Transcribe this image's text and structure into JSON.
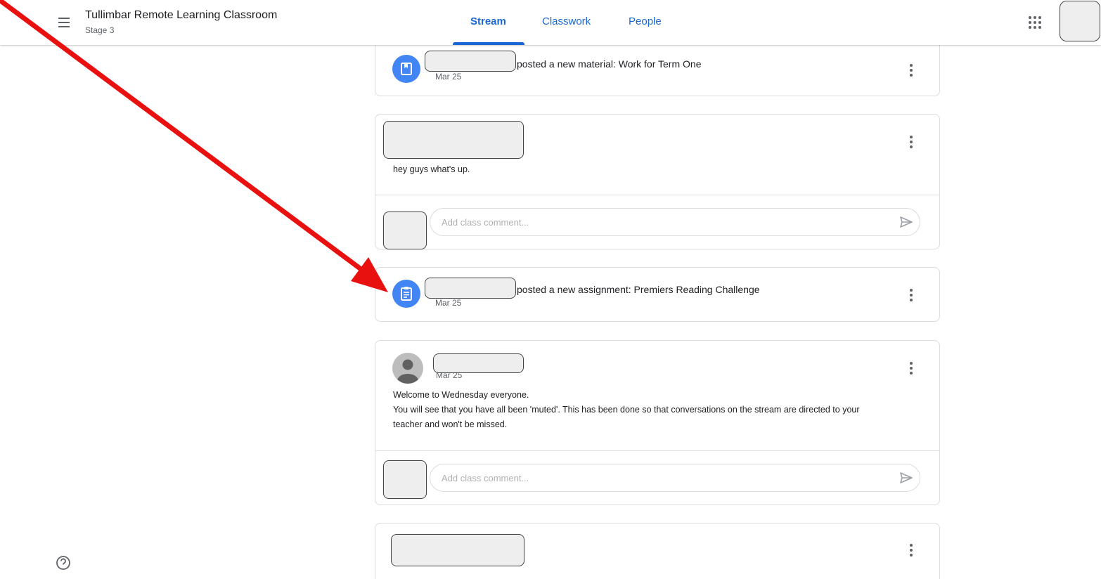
{
  "header": {
    "class_title": "Tullimbar Remote Learning Classroom",
    "class_subtitle": "Stage 3",
    "tabs": [
      {
        "label": "Stream",
        "active": true
      },
      {
        "label": "Classwork",
        "active": false
      },
      {
        "label": "People",
        "active": false
      }
    ]
  },
  "stream": {
    "posts": [
      {
        "type": "material",
        "icon": "material-icon",
        "title": "posted a new material: Work for Term One",
        "date": "Mar 25"
      },
      {
        "type": "announcement",
        "text": "hey guys what's up.",
        "comment_placeholder": "Add class comment..."
      },
      {
        "type": "assignment",
        "icon": "assignment-icon",
        "title": "posted a new assignment: Premiers Reading Challenge",
        "date": "Mar 25"
      },
      {
        "type": "announcement",
        "date": "Mar 25",
        "lines": [
          "Welcome to Wednesday everyone.",
          "You will see that you have all been 'muted'. This has been done so that conversations on the stream are directed to your",
          "teacher and won't be missed."
        ],
        "comment_placeholder": "Add class comment..."
      },
      {
        "type": "announcement"
      }
    ]
  },
  "colors": {
    "accent": "#1967d2",
    "avatar_blue": "#4285f4",
    "annotation_arrow": "#e8110f"
  }
}
